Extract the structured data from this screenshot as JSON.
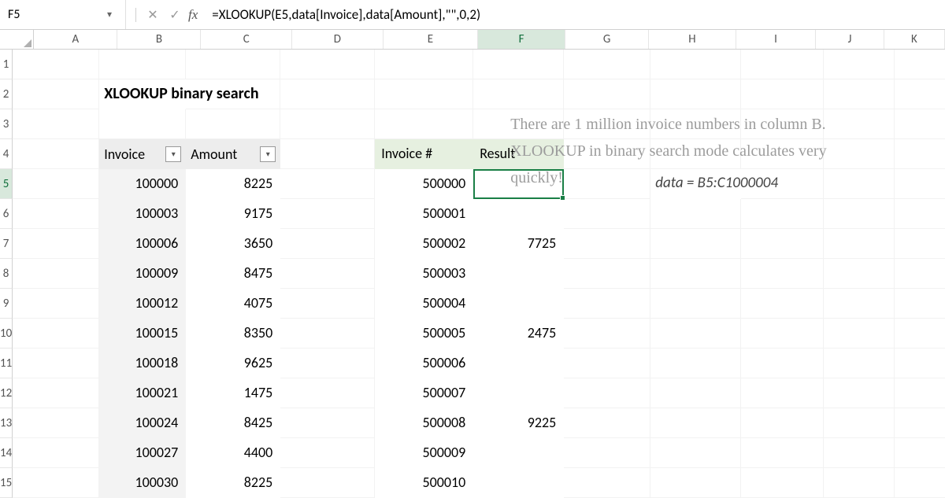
{
  "name_box": "F5",
  "formula": "=XLOOKUP(E5,data[Invoice],data[Amount],\"\",0,2)",
  "columns": [
    "A",
    "B",
    "C",
    "D",
    "E",
    "F",
    "G",
    "H",
    "I",
    "J",
    "K"
  ],
  "active_col": "F",
  "rows": [
    "1",
    "2",
    "3",
    "4",
    "5",
    "6",
    "7",
    "8",
    "9",
    "10",
    "11",
    "12",
    "13",
    "14",
    "15"
  ],
  "active_row": "5",
  "title": "XLOOKUP binary search",
  "table1": {
    "headers": {
      "invoice": "Invoice",
      "amount": "Amount"
    },
    "rows": [
      {
        "invoice": "100000",
        "amount": "8225"
      },
      {
        "invoice": "100003",
        "amount": "9175"
      },
      {
        "invoice": "100006",
        "amount": "3650"
      },
      {
        "invoice": "100009",
        "amount": "8475"
      },
      {
        "invoice": "100012",
        "amount": "4075"
      },
      {
        "invoice": "100015",
        "amount": "8350"
      },
      {
        "invoice": "100018",
        "amount": "9625"
      },
      {
        "invoice": "100021",
        "amount": "1475"
      },
      {
        "invoice": "100024",
        "amount": "8425"
      },
      {
        "invoice": "100027",
        "amount": "4400"
      },
      {
        "invoice": "100030",
        "amount": "8225"
      }
    ]
  },
  "table2": {
    "headers": {
      "invoice": "Invoice #",
      "result": "Result"
    },
    "rows": [
      {
        "invoice": "500000",
        "result": ""
      },
      {
        "invoice": "500001",
        "result": ""
      },
      {
        "invoice": "500002",
        "result": "7725"
      },
      {
        "invoice": "500003",
        "result": ""
      },
      {
        "invoice": "500004",
        "result": ""
      },
      {
        "invoice": "500005",
        "result": "2475"
      },
      {
        "invoice": "500006",
        "result": ""
      },
      {
        "invoice": "500007",
        "result": ""
      },
      {
        "invoice": "500008",
        "result": "9225"
      },
      {
        "invoice": "500009",
        "result": ""
      },
      {
        "invoice": "500010",
        "result": ""
      }
    ]
  },
  "annotation_range": "data = B5:C1000004",
  "annotation_note": "There are 1 million invoice numbers in column B. XLOOKUP in binary search mode calculates very quickly!"
}
